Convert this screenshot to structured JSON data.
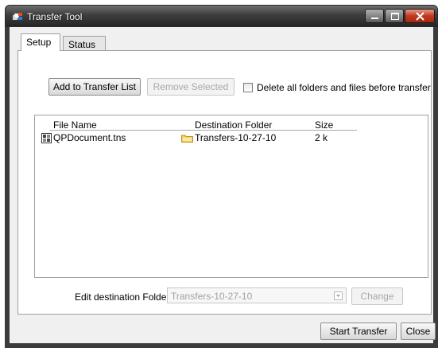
{
  "window": {
    "title": "Transfer Tool",
    "controls": {
      "minimize": "minimize-icon",
      "maximize": "maximize-icon",
      "close": "close-icon"
    }
  },
  "tabs": [
    {
      "label": "Setup",
      "active": true
    },
    {
      "label": "Status",
      "active": false
    }
  ],
  "toolbar": {
    "add_label": "Add to Transfer List",
    "remove_label": "Remove Selected",
    "delete_checkbox_label": "Delete all folders and files before transfer",
    "delete_checked": false
  },
  "file_list": {
    "columns": [
      "File Name",
      "Destination Folder",
      "Size"
    ],
    "rows": [
      {
        "file_name": "QPDocument.tns",
        "destination": "Transfers-10-27-10",
        "size": "2 k"
      }
    ]
  },
  "destination": {
    "label": "Edit destination Folder:",
    "value": "Transfers-10-27-10",
    "change_label": "Change"
  },
  "footer": {
    "start_label": "Start Transfer",
    "close_label": "Close"
  },
  "colors": {
    "titlebar": "#3e3e3e",
    "close_button": "#c0391f",
    "panel_bg": "#ffffff",
    "frame_bg": "#f0f0f0"
  }
}
